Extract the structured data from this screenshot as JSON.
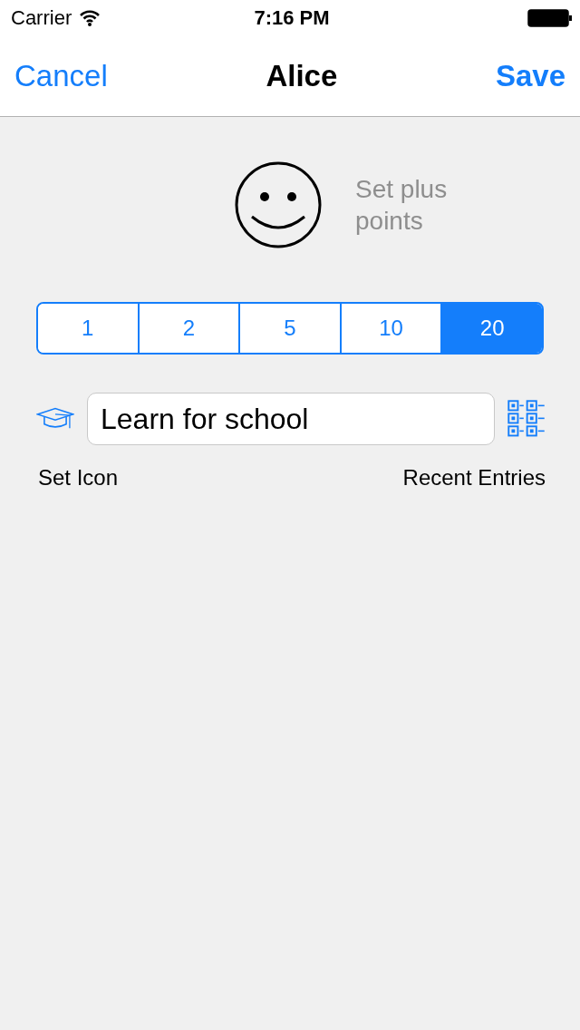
{
  "status_bar": {
    "carrier": "Carrier",
    "time": "7:16 PM"
  },
  "nav": {
    "cancel": "Cancel",
    "title": "Alice",
    "save": "Save"
  },
  "points_label": "Set plus points",
  "segments": [
    {
      "label": "1",
      "selected": false
    },
    {
      "label": "2",
      "selected": false
    },
    {
      "label": "5",
      "selected": false
    },
    {
      "label": "10",
      "selected": false
    },
    {
      "label": "20",
      "selected": true
    }
  ],
  "entry": {
    "value": "Learn for school"
  },
  "set_icon": "Set Icon",
  "recent_entries": "Recent Entries"
}
